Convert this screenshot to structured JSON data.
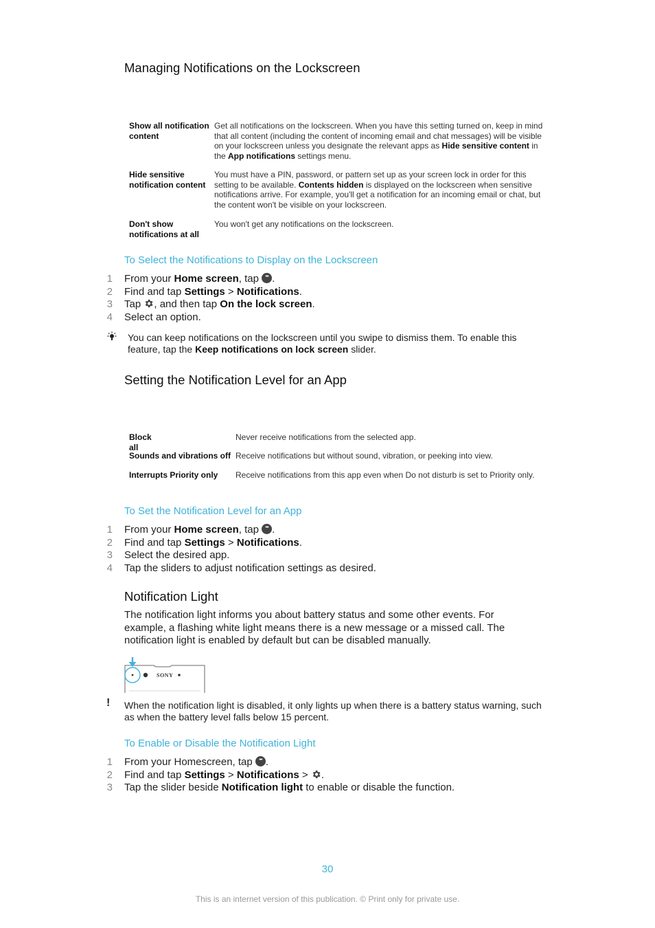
{
  "section1": {
    "title": "Managing Notifications on the Lockscreen",
    "table": [
      {
        "key": "Show all notification content",
        "value_parts": [
          "Get all notifications on the lockscreen. When you have this setting turned on, keep in mind that all content (including the content of incoming email and chat messages) will be visible on your lockscreen unless you designate the relevant apps as ",
          "Hide sensitive content",
          " in the ",
          "App notifications",
          " settings menu."
        ]
      },
      {
        "key": "Hide sensitive notification content",
        "value_parts": [
          "You must have a PIN, password, or pattern set up as your screen lock in order for this setting to be available. ",
          "Contents hidden",
          " is displayed on the lockscreen when sensitive notifications arrive. For example, you'll get a notification for an incoming email or chat, but the content won't be visible on your lockscreen."
        ]
      },
      {
        "key": "Don't show notifications at all",
        "value_parts": [
          "You won't get any notifications on the lockscreen."
        ]
      }
    ],
    "procedure_title": "To Select the Notifications to Display on the Lockscreen",
    "steps": [
      {
        "num": "1",
        "a": "From your ",
        "b": "Home screen",
        "c": ", tap ",
        "icon": "apps-icon",
        "d": "."
      },
      {
        "num": "2",
        "a": "Find and tap ",
        "b": "Settings",
        "c": " > ",
        "b2": "Notifications",
        "d": "."
      },
      {
        "num": "3",
        "a": "Tap ",
        "icon": "gear-icon",
        "c": ", and then tap ",
        "b": "On the lock screen",
        "d": "."
      },
      {
        "num": "4",
        "a": "Select an option."
      }
    ],
    "tip": {
      "icon": "lightbulb-icon",
      "a": "You can keep notifications on the lockscreen until you swipe to dismiss them. To enable this feature, tap the ",
      "b": "Keep notifications on lock screen",
      "c": " slider."
    }
  },
  "section2": {
    "title": "Setting the Notification Level for an App",
    "table": [
      {
        "key": "Block all",
        "value": "Never receive notifications from the selected app."
      },
      {
        "key": "Sounds and vibrations off",
        "value": "Receive notifications but without sound, vibration, or peeking into view."
      },
      {
        "key": "Interrupts Priority only",
        "value": "Receive notifications from this app even when Do not disturb is set to Priority only."
      }
    ],
    "procedure_title": "To Set the Notification Level for an App",
    "steps": [
      {
        "num": "1",
        "a": "From your ",
        "b": "Home screen",
        "c": ", tap ",
        "d": "."
      },
      {
        "num": "2",
        "a": "Find and tap ",
        "b": "Settings",
        "c": " > ",
        "b2": "Notifications",
        "d": "."
      },
      {
        "num": "3",
        "a": "Select the desired app."
      },
      {
        "num": "4",
        "a": "Tap the sliders to adjust notification settings as desired."
      }
    ]
  },
  "section3": {
    "title": "Notification Light",
    "paragraph": "The notification light informs you about battery status and some other events. For example, a flashing white light means there is a new message or a missed call. The notification light is enabled by default but can be disabled manually.",
    "illustration": {
      "brand": "SONY"
    },
    "warning": {
      "icon": "exclamation-icon",
      "text": "When the notification light is disabled, it only lights up when there is a battery status warning, such as when the battery level falls below 15 percent."
    },
    "procedure_title": "To Enable or Disable the Notification Light",
    "steps": [
      {
        "num": "1",
        "a": "From your Homescreen, tap ",
        "d": "."
      },
      {
        "num": "2",
        "a": "Find and tap ",
        "b": "Settings",
        "c": " > ",
        "b2": "Notifications",
        "e": " > ",
        "d": "."
      },
      {
        "num": "3",
        "a": "Tap the slider beside ",
        "b": "Notification light",
        "c": " to enable or disable the function."
      }
    ]
  },
  "footer": {
    "page_number": "30",
    "notice": "This is an internet version of this publication. © Print only for private use."
  },
  "colors": {
    "accent": "#3fb3d9",
    "text": "#222222"
  }
}
